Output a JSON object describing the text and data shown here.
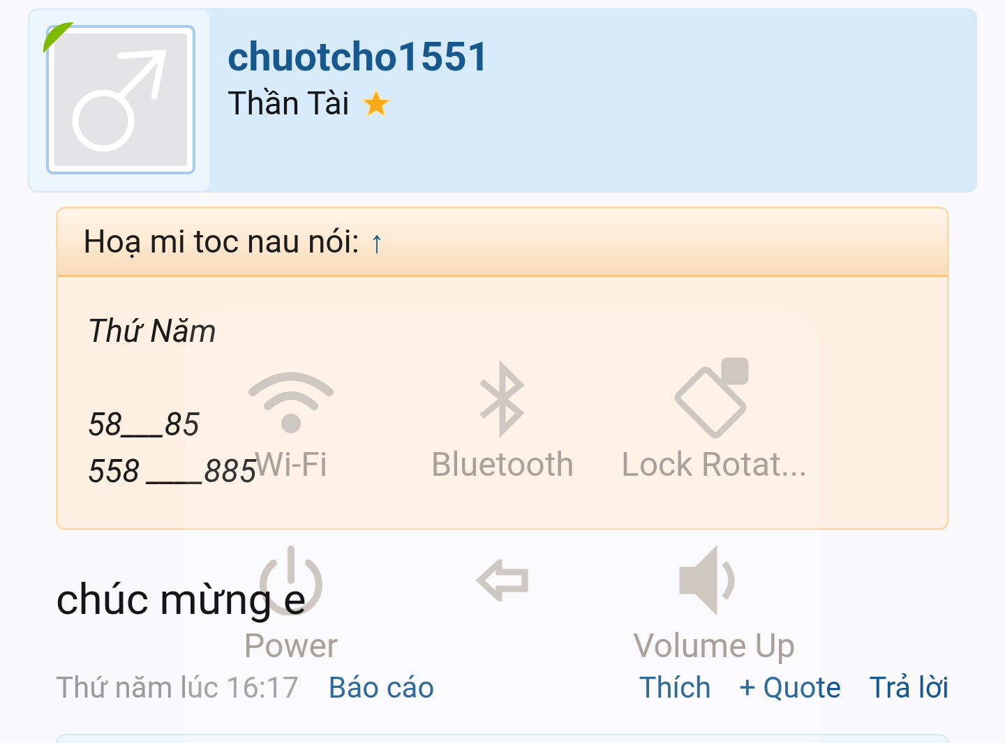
{
  "profile": {
    "username": "chuotcho1551",
    "title": "Thần Tài",
    "online": true
  },
  "quote": {
    "author_line": "Hoạ mi toc nau nói:",
    "jump": "↑",
    "lines": [
      "Thứ Năm",
      "58___85",
      "558 ____885"
    ]
  },
  "message": "chúc mừng e",
  "footer": {
    "time": "Thứ năm lúc 16:17",
    "links": [
      "Báo cáo",
      "Thích",
      "+ Quote",
      "Trả lời"
    ]
  },
  "overlay_menu": {
    "items": [
      {
        "kind": "wifi",
        "label": "Wi-Fi"
      },
      {
        "kind": "bluetooth",
        "label": "Bluetooth"
      },
      {
        "kind": "rotation",
        "label": "Lock Rotat..."
      },
      {
        "kind": "power",
        "label": "Power"
      },
      {
        "kind": "back"
      },
      {
        "kind": "volume",
        "label": "Volume Up"
      }
    ]
  }
}
